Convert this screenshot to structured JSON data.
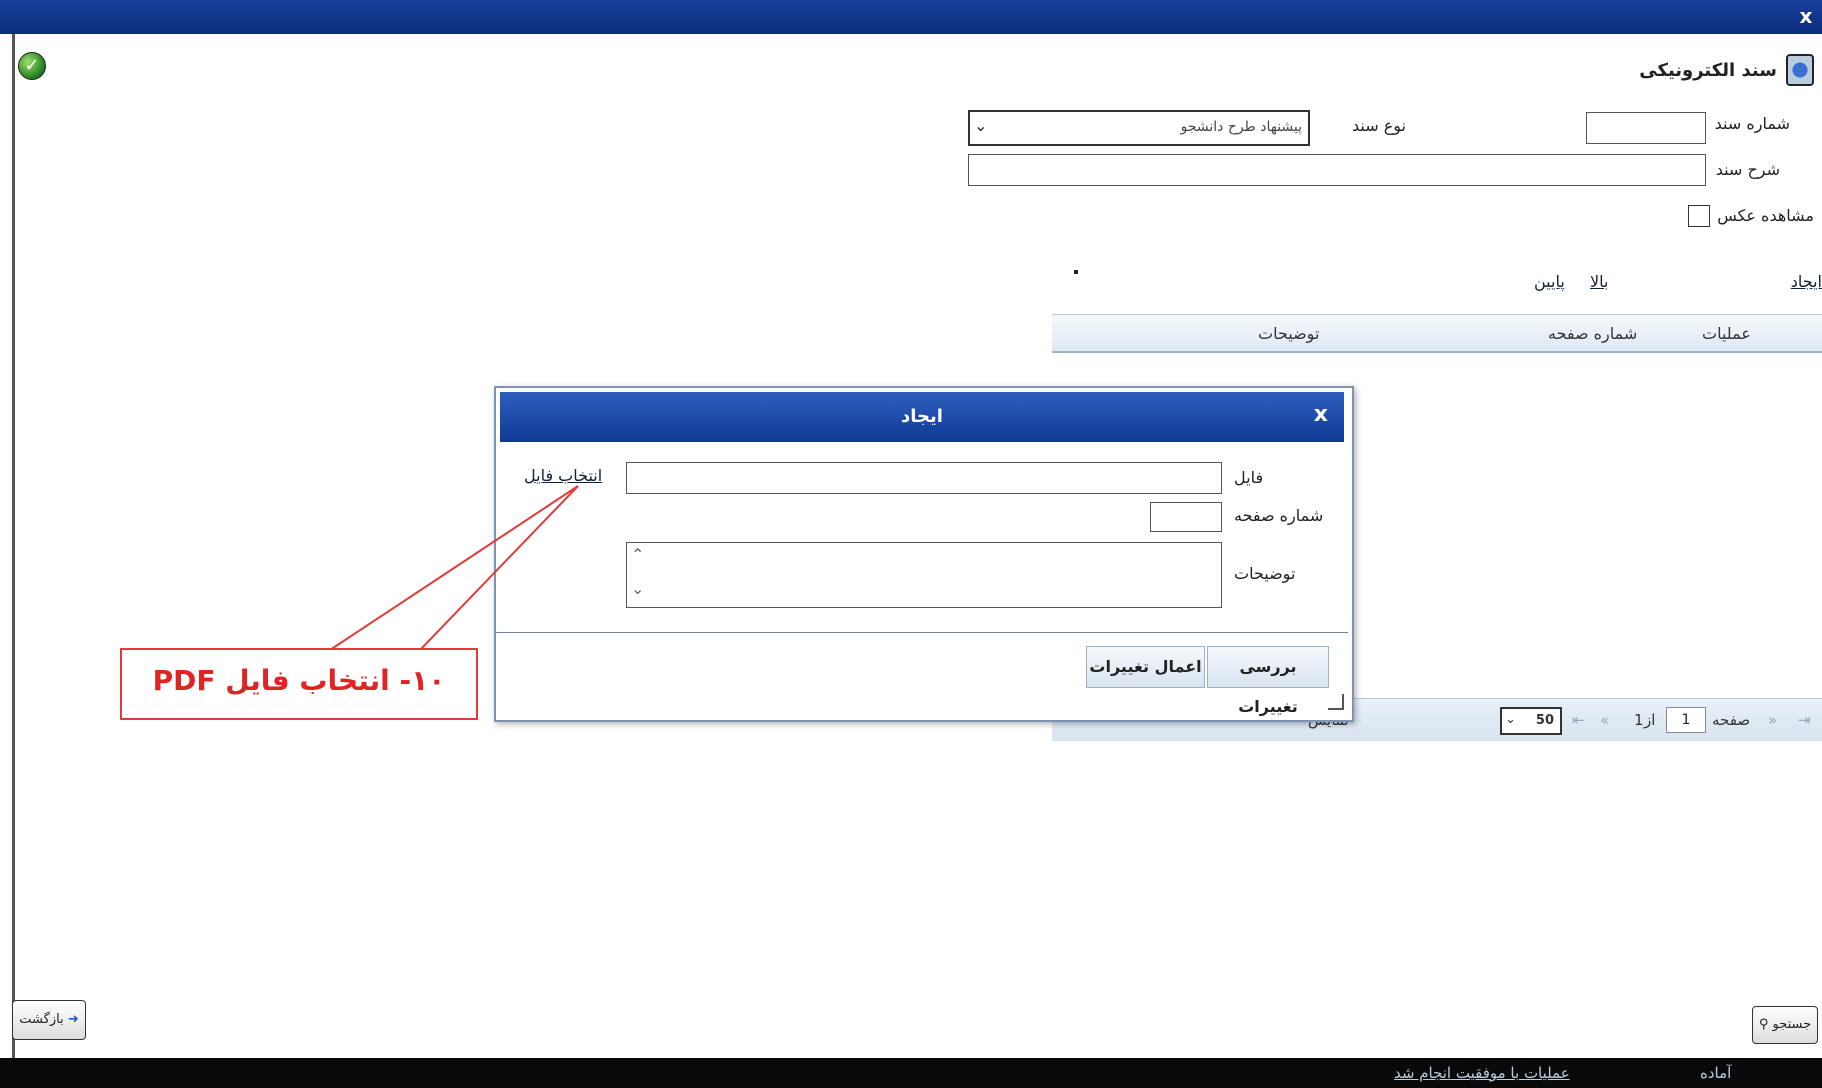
{
  "window": {
    "close_glyph": "x"
  },
  "header": {
    "title": "سند الکترونیکی"
  },
  "form": {
    "doc_number_label": "شماره سند",
    "doc_number_value": "",
    "doc_type_label": "نوع سند",
    "doc_type_value": "پیشنهاد طرح دانشجو",
    "doc_desc_label": "شرح سند",
    "doc_desc_value": "",
    "view_image_label": "مشاهده عکس"
  },
  "actions": {
    "create": "ایجاد",
    "up": "بالا",
    "down": "پایین"
  },
  "grid": {
    "columns": [
      "عملیات",
      "شماره صفحه",
      "توضیحات"
    ]
  },
  "pager": {
    "page_label": "صفحه",
    "page_value": "1",
    "of_label": "از",
    "total_pages": "1",
    "page_size": "50",
    "display_label": "نمایش"
  },
  "dialog": {
    "title": "ایجاد",
    "close_glyph": "x",
    "file_label": "فایل",
    "file_value": "",
    "select_file_link": "انتخاب فایل",
    "page_number_label": "شماره صفحه",
    "page_number_value": "",
    "description_label": "توضیحات",
    "review_button": "بررسی تغییرات",
    "apply_button": "اعمال تغییرات"
  },
  "callout": {
    "text": "۱۰- انتخاب فایل PDF",
    "color": "#e02424"
  },
  "bottom": {
    "search_button": "جستجو",
    "back_button": "بازگشت"
  },
  "status": {
    "left_text": "عملیات با موفقیت انجام شد",
    "right_text": "آماده"
  },
  "colors": {
    "titlebar": "#0b2c7e",
    "dialog_title": "#1f4aa8",
    "callout_border": "#e23a3a"
  },
  "icons": {
    "ok": "check-circle-icon",
    "header": "document-icon"
  }
}
